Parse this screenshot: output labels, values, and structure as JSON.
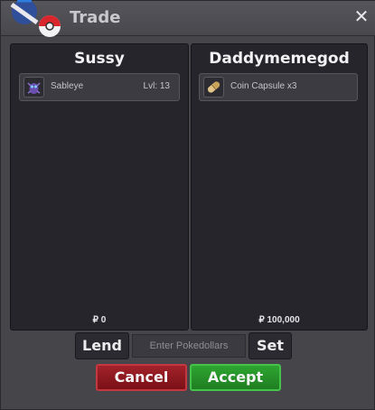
{
  "window": {
    "title": "Trade",
    "close_icon": "close-icon"
  },
  "left_panel": {
    "player_name": "Sussy",
    "item": {
      "icon": "sableye-icon",
      "name": "Sableye",
      "level": "Lvl: 13"
    },
    "money": "₽ 0"
  },
  "right_panel": {
    "player_name": "Daddymemegod",
    "item": {
      "icon": "coin-capsule-icon",
      "name": "Coin Capsule  x3"
    },
    "money": "₽ 100,000"
  },
  "controls": {
    "lend_label": "Lend",
    "pokedollars_placeholder": "Enter Pokedollars",
    "set_label": "Set",
    "cancel_label": "Cancel",
    "accept_label": "Accept"
  },
  "colors": {
    "cancel": "#9b1c23",
    "accept": "#2a9a2d",
    "panel_bg": "#25252b"
  }
}
